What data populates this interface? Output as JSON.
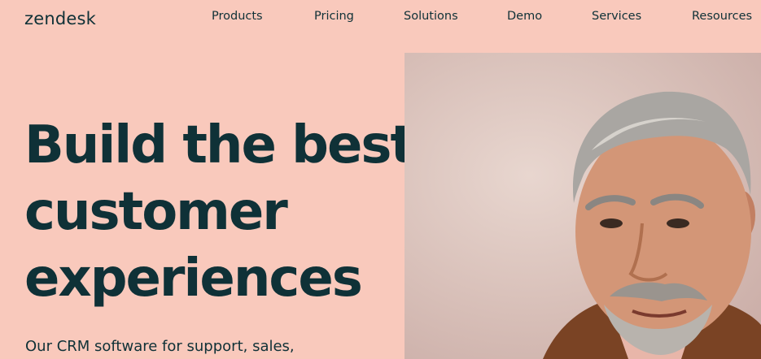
{
  "header": {
    "logo": "zendesk",
    "nav": [
      "Products",
      "Pricing",
      "Solutions",
      "Demo",
      "Services",
      "Resources"
    ]
  },
  "hero": {
    "title_lines": [
      "Build the best",
      "customer",
      "experiences"
    ],
    "subtitle": "Our CRM software for support, sales,"
  },
  "colors": {
    "background": "#f9c9bc",
    "text": "#0f3137"
  },
  "images": {
    "hero_photo": "portrait-of-smiling-gray-haired-man"
  }
}
